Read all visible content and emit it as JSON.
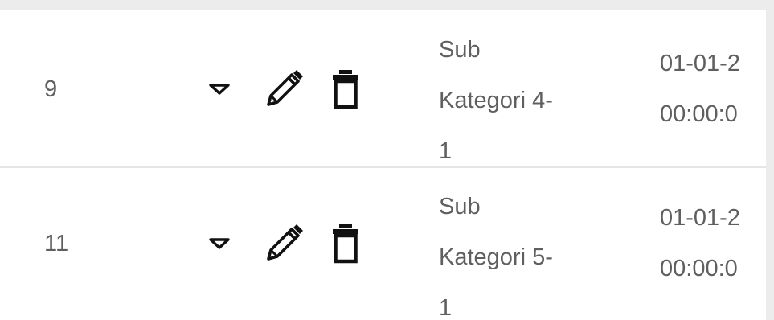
{
  "table": {
    "rows": [
      {
        "id": "9",
        "name_lines": [
          "Sub",
          "Kategori 4-",
          "1"
        ],
        "date_lines": [
          "01-01-2",
          "00:00:0"
        ]
      },
      {
        "id": "11",
        "name_lines": [
          "Sub",
          "Kategori 5-",
          "1"
        ],
        "date_lines": [
          "01-01-2",
          "00:00:0"
        ]
      }
    ],
    "actions": {
      "expand_icon": "triangle-down-icon",
      "edit_icon": "pencil-icon",
      "delete_icon": "trash-icon"
    },
    "colors": {
      "text": "#5f5f5f",
      "icon": "#111111",
      "divider": "#e6e6e6",
      "background": "#ececec"
    }
  }
}
